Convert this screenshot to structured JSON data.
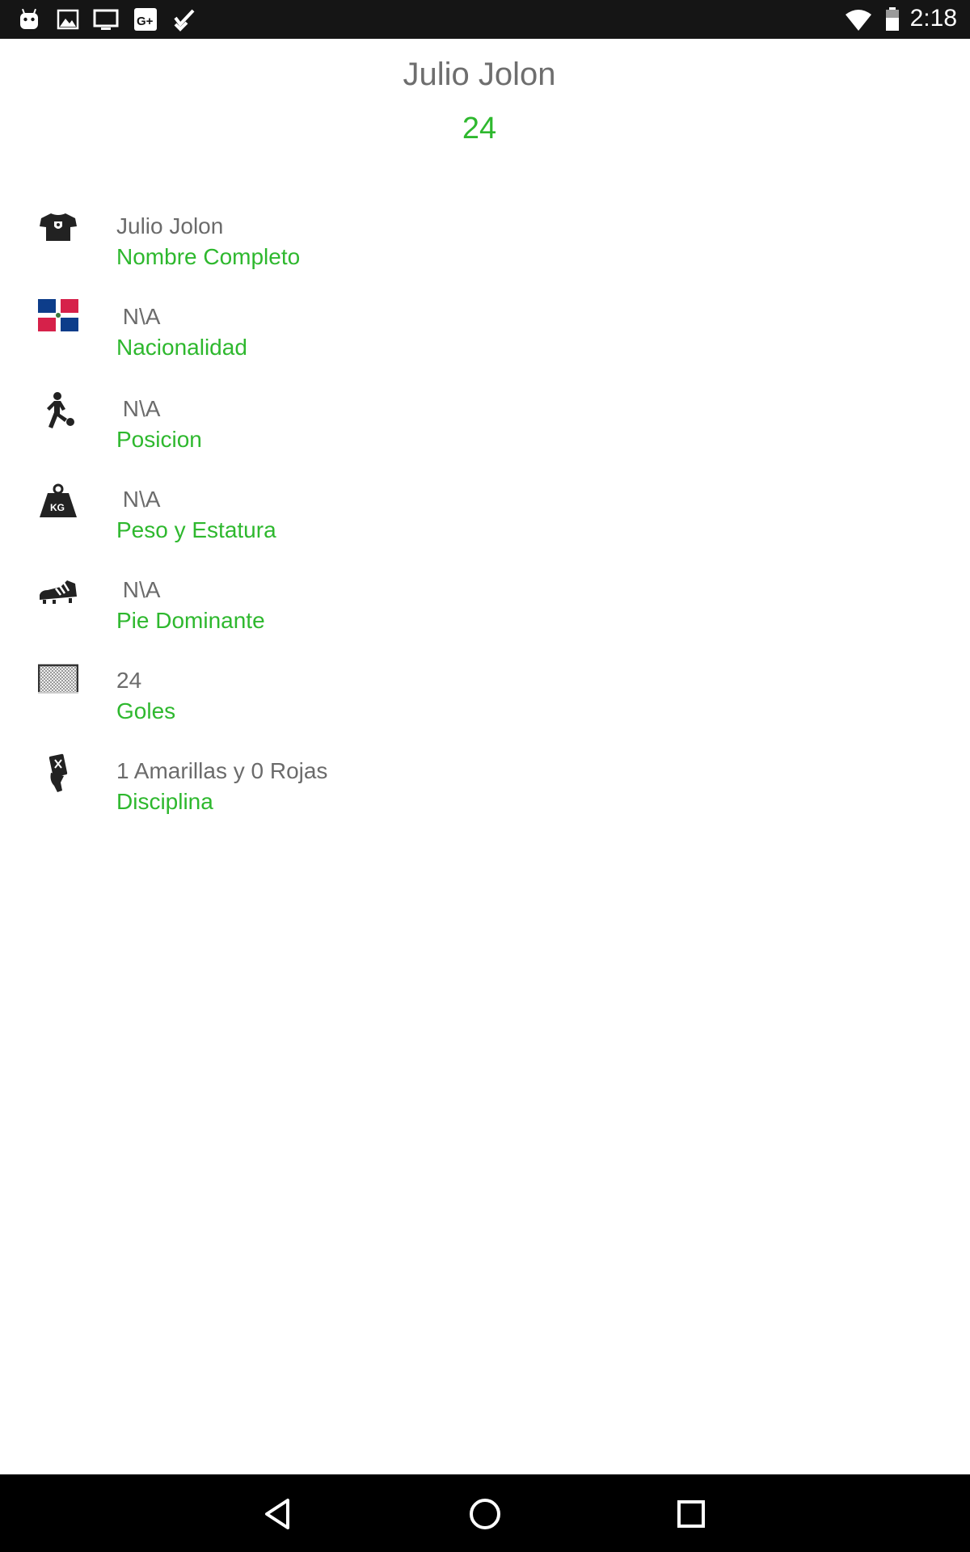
{
  "status_bar": {
    "time": "2:18",
    "left_icons": [
      "android-icon",
      "image-icon",
      "tv-icon",
      "google-plus-icon",
      "check-task-icon"
    ],
    "right_icons": [
      "wifi-icon",
      "battery-icon"
    ]
  },
  "header": {
    "name": "Julio Jolon",
    "number": "24"
  },
  "details": [
    {
      "icon": "jersey-icon",
      "value": "Julio Jolon",
      "label": "Nombre Completo"
    },
    {
      "icon": "flag-icon",
      "value": " N\\A",
      "label": "Nacionalidad"
    },
    {
      "icon": "player-kicking-icon",
      "value": " N\\A",
      "label": "Posicion"
    },
    {
      "icon": "kg-weight-icon",
      "value": " N\\A",
      "label": "Peso y Estatura"
    },
    {
      "icon": "cleat-shoe-icon",
      "value": " N\\A",
      "label": "Pie Dominante"
    },
    {
      "icon": "goal-net-icon",
      "value": "24",
      "label": "Goles"
    },
    {
      "icon": "referee-card-icon",
      "value": "1 Amarillas y 0 Rojas",
      "label": "Disciplina"
    }
  ],
  "colors": {
    "accent_green": "#2eb82e",
    "text_gray": "#6b6b6b",
    "status_bar_bg": "#151515",
    "nav_bar_bg": "#000000"
  },
  "nav_bar": {
    "buttons": [
      "back-icon",
      "home-icon",
      "recents-icon"
    ]
  }
}
